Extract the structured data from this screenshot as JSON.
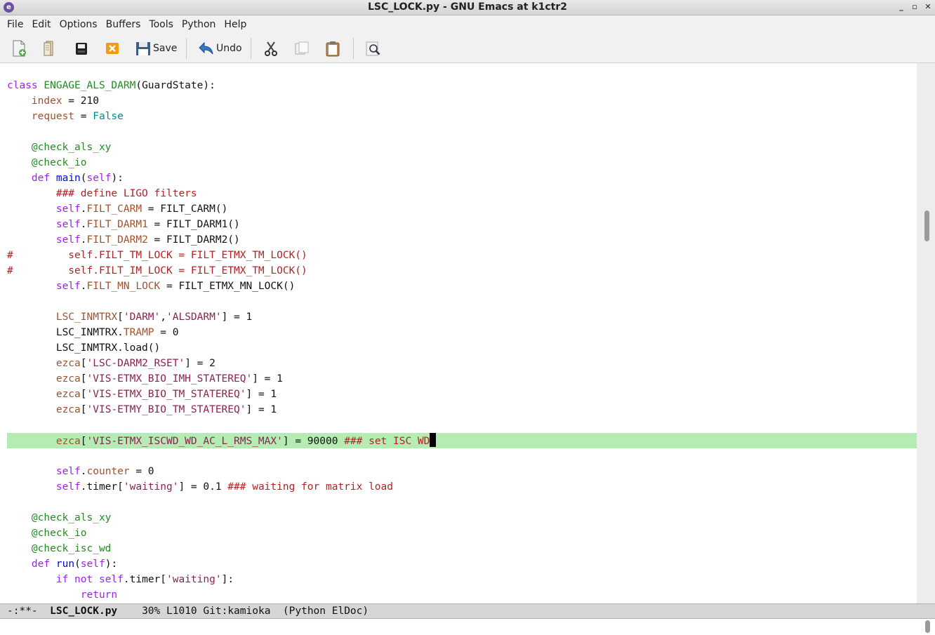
{
  "window": {
    "title": "LSC_LOCK.py - GNU Emacs at k1ctr2",
    "app_icon": "emacs-icon",
    "controls": [
      "minimize-icon",
      "maximize-icon",
      "close-icon"
    ],
    "control_glyphs": [
      "_",
      "▫",
      "✕"
    ]
  },
  "menu": {
    "items": [
      "File",
      "Edit",
      "Options",
      "Buffers",
      "Tools",
      "Python",
      "Help"
    ]
  },
  "toolbar": {
    "save_label": "Save",
    "undo_label": "Undo",
    "icons": [
      "new-file-icon",
      "open-file-icon",
      "dired-icon",
      "close-buffer-icon",
      "save-icon",
      "undo-icon",
      "cut-icon",
      "copy-icon",
      "paste-icon",
      "search-icon"
    ]
  },
  "code": {
    "lines": [
      "",
      "class ENGAGE_ALS_DARM(GuardState):",
      "    index = 210",
      "    request = False",
      "",
      "    @check_als_xy",
      "    @check_io",
      "    def main(self):",
      "        ### define LIGO filters",
      "        self.FILT_CARM = FILT_CARM()",
      "        self.FILT_DARM1 = FILT_DARM1()",
      "        self.FILT_DARM2 = FILT_DARM2()",
      "#         self.FILT_TM_LOCK = FILT_ETMX_TM_LOCK()",
      "#         self.FILT_IM_LOCK = FILT_ETMX_TM_LOCK()",
      "        self.FILT_MN_LOCK = FILT_ETMX_MN_LOCK()",
      "",
      "        LSC_INMTRX['DARM','ALSDARM'] = 1",
      "        LSC_INMTRX.TRAMP = 0",
      "        LSC_INMTRX.load()",
      "        ezca['LSC-DARM2_RSET'] = 2",
      "        ezca['VIS-ETMX_BIO_IMH_STATEREQ'] = 1",
      "        ezca['VIS-ETMX_BIO_TM_STATEREQ'] = 1",
      "        ezca['VIS-ETMY_BIO_TM_STATEREQ'] = 1",
      "",
      "        ezca['VIS-ETMX_ISCWD_WD_AC_L_RMS_MAX'] = 90000 ### set ISC WD",
      "",
      "        self.counter = 0",
      "        self.timer['waiting'] = 0.1 ### waiting for matrix load",
      "",
      "    @check_als_xy",
      "    @check_io",
      "    @check_isc_wd",
      "    def run(self):",
      "        if not self.timer['waiting']:",
      "            return"
    ],
    "highlighted_line_index": 24
  },
  "modeline": {
    "status": "-:**-",
    "buffer_name": "LSC_LOCK.py",
    "percent": "30%",
    "line": "L1010",
    "vc": "Git:kamioka",
    "modes": "(Python ElDoc)"
  },
  "colors": {
    "keyword": "#a020f0",
    "function_name": "#0000ff",
    "variable": "#a0522d",
    "constant": "#008b8b",
    "string": "#8b2252",
    "comment": "#b22222",
    "type_decorator": "#228b22",
    "line_highlight": "#b4ecb4"
  }
}
